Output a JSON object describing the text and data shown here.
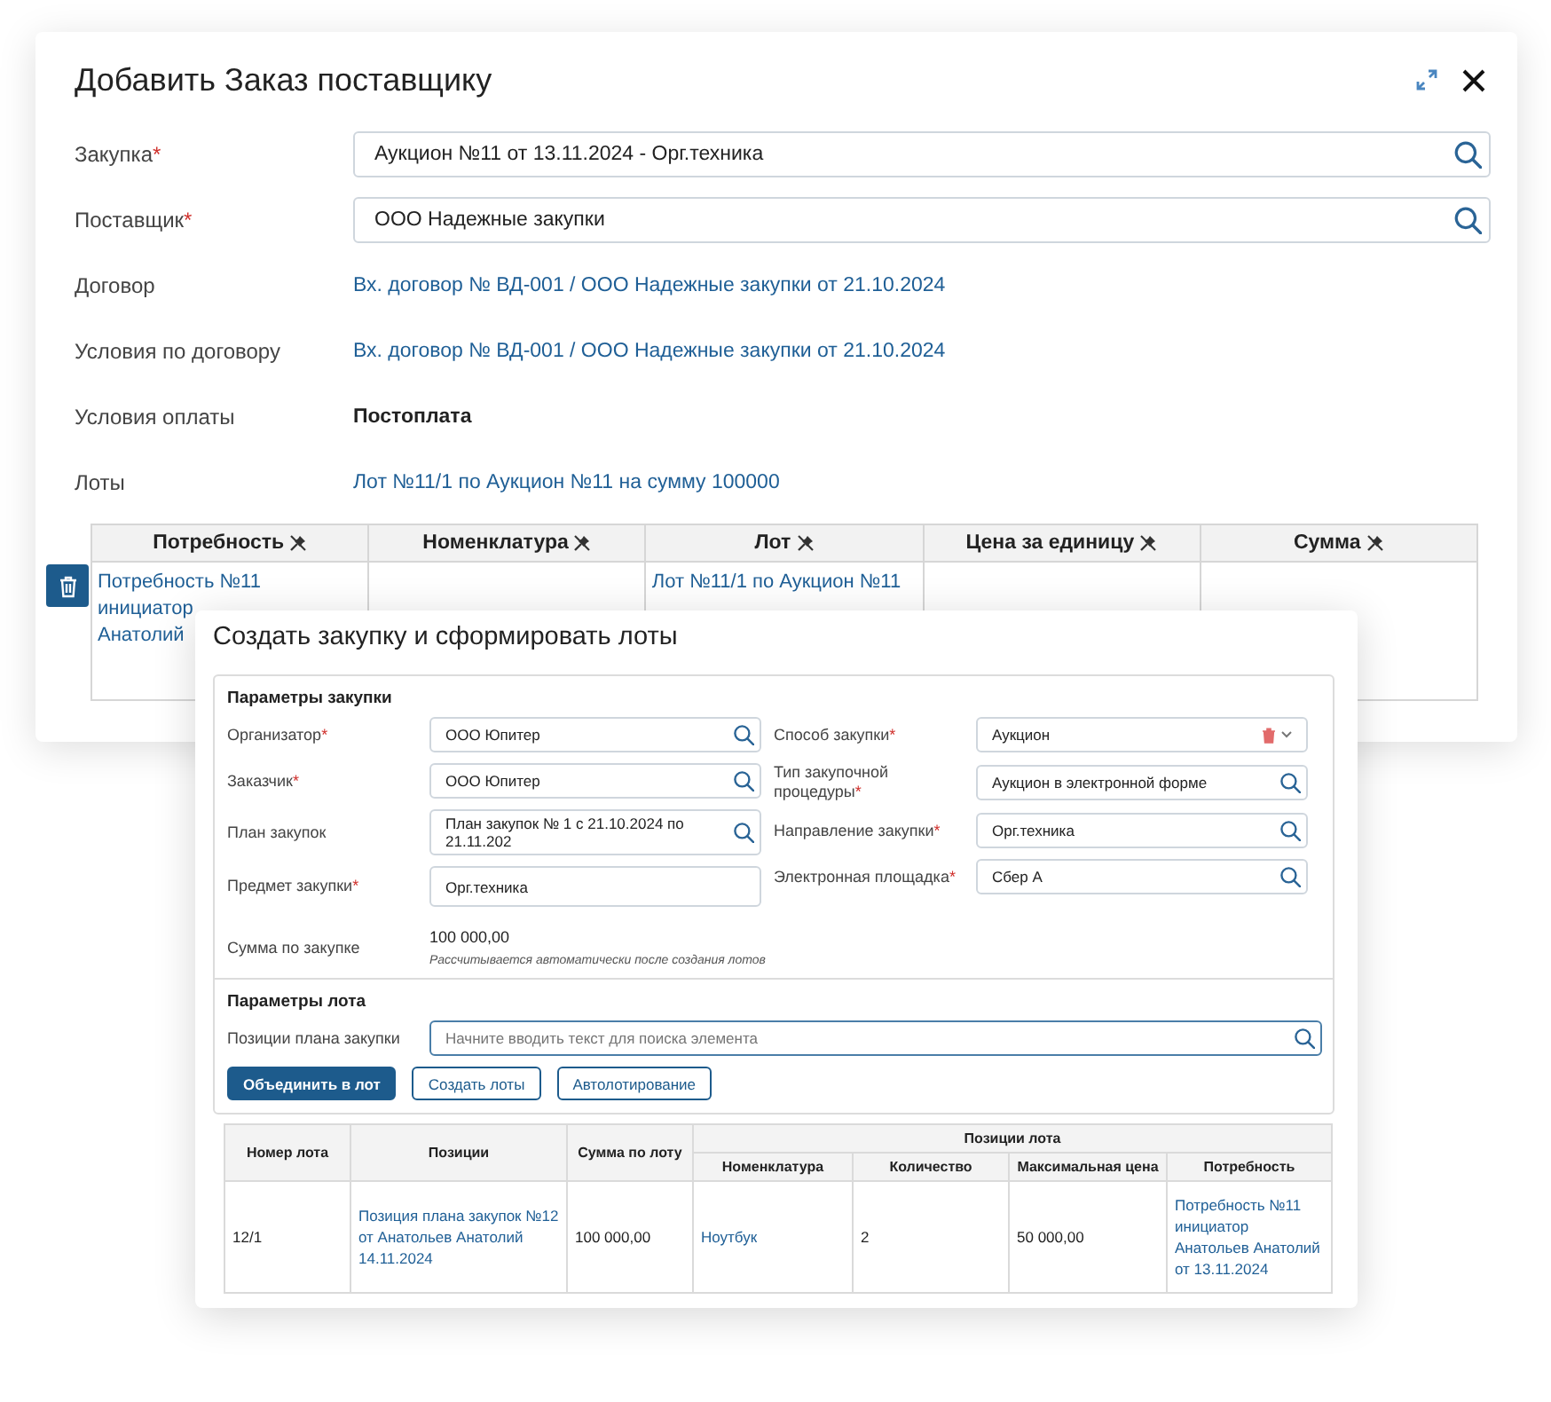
{
  "order_dialog": {
    "title": "Добавить Заказ поставщику",
    "fields": [
      {
        "label": "Закупка",
        "required_mark": "*",
        "kind": "search",
        "value": "Аукцион №11 от 13.11.2024 - Орг.техника"
      },
      {
        "label": "Поставщик",
        "required_mark": "*",
        "kind": "search",
        "value": "ООО Надежные закупки"
      },
      {
        "label": "Договор",
        "kind": "link",
        "value": "Вх. договор № ВД-001 / ООО Надежные закупки от 21.10.2024"
      },
      {
        "label": "Условия по договору",
        "kind": "link",
        "value": "Вх. договор № ВД-001 / ООО Надежные закупки от 21.10.2024"
      },
      {
        "label": "Условия оплаты",
        "kind": "text",
        "value": "Постоплата"
      },
      {
        "label": "Лоты",
        "kind": "link",
        "value": "Лот №11/1 по Аукцион №11 на сумму 100000"
      }
    ],
    "table": {
      "columns": [
        "Потребность",
        "Номенклатура",
        "Лот",
        "Цена за единицу",
        "Сумма"
      ],
      "rows": [
        {
          "cells": [
            {
              "text": "Потребность №11\nинициатор\nАнатолий",
              "link": true
            },
            {},
            {
              "text": "Лот №11/1 по Аукцион №11",
              "link": true
            },
            {},
            {}
          ]
        }
      ]
    }
  },
  "create_dialog": {
    "title": "Создать закупку и сформировать лоты",
    "purchase_section": {
      "heading": "Параметры закупки",
      "left_fields": [
        {
          "label": "Организатор",
          "required_mark": "*",
          "kind": "search",
          "value": "ООО Юпитер"
        },
        {
          "label": "Заказчик",
          "required_mark": "*",
          "kind": "search",
          "value": "ООО Юпитер"
        },
        {
          "label": "План закупок",
          "kind": "search",
          "value": "План закупок № 1 с 21.10.2024 по 21.11.202"
        },
        {
          "label": "Предмет закупки",
          "required_mark": "*",
          "kind": "input",
          "value": "Орг.техника"
        }
      ],
      "right_fields": [
        {
          "label": "Способ закупки",
          "required_mark": "*",
          "kind": "select",
          "value": "Аукцион"
        },
        {
          "label": "Тип закупочной процедуры",
          "required_mark": "*",
          "kind": "search",
          "value": "Аукцион в электронной форме"
        },
        {
          "label": "Направление закупки",
          "required_mark": "*",
          "kind": "search",
          "value": "Орг.техника"
        },
        {
          "label": "Электронная площадка",
          "required_mark": "*",
          "kind": "search",
          "value": "Сбер А"
        }
      ],
      "total": {
        "label": "Сумма по закупке",
        "value": "100 000,00",
        "hint": "Рассчитывается автоматически после создания лотов"
      }
    },
    "lot_section": {
      "heading": "Параметры лота",
      "search_label": "Позиции плана закупки",
      "search_placeholder": "Начните вводить текст для поиска элемента",
      "buttons": [
        {
          "label": "Объединить в лот",
          "kind": "primary"
        },
        {
          "label": "Создать лоты",
          "kind": "outline"
        },
        {
          "label": "Автолотирование",
          "kind": "outline"
        }
      ]
    },
    "table": {
      "columns": [
        "Номер лота",
        "Позиции",
        "Сумма по лоту"
      ],
      "group": "Позиции лота",
      "sub_columns": [
        "Номенклатура",
        "Количество",
        "Максимальная цена",
        "Потребность"
      ],
      "rows": [
        {
          "cells": [
            {
              "text": "12/1",
              "link": false
            },
            {
              "text": "Позиция плана закупок №12 от Анатольев Анатолий 14.11.2024",
              "link": true
            },
            {
              "text": "100 000,00",
              "link": false
            },
            {
              "text": "Ноутбук",
              "link": true
            },
            {
              "text": "2",
              "link": false
            },
            {
              "text": "50 000,00",
              "link": false
            },
            {
              "text": "Потребность №11 инициатор Анатольев Анатолий от 13.11.2024",
              "link": true
            }
          ]
        }
      ]
    }
  }
}
